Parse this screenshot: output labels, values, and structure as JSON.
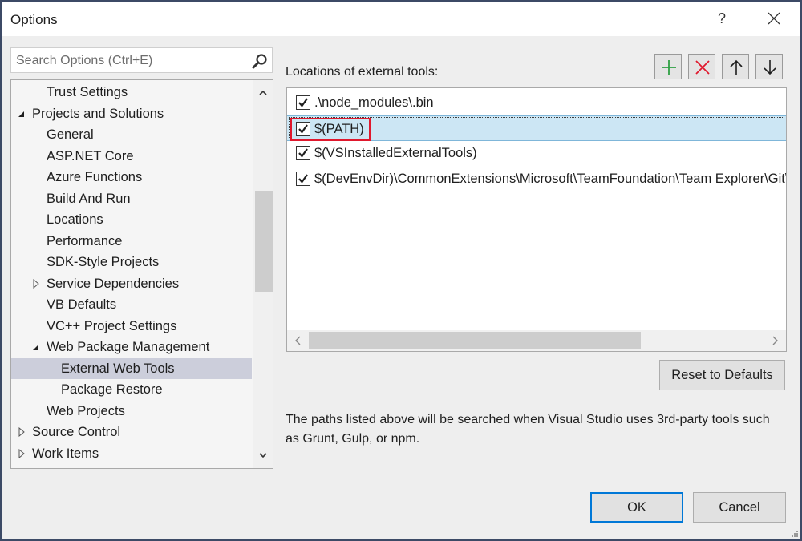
{
  "window": {
    "title": "Options",
    "help_label": "?",
    "close_icon": "close-icon"
  },
  "search": {
    "placeholder": "Search Options (Ctrl+E)",
    "value": "",
    "icon": "search-icon"
  },
  "tree": {
    "items": [
      {
        "label": "Trust Settings",
        "level": 1,
        "expander": "none",
        "selected": false
      },
      {
        "label": "Projects and Solutions",
        "level": 0,
        "expander": "expanded",
        "selected": false
      },
      {
        "label": "General",
        "level": 1,
        "expander": "none",
        "selected": false
      },
      {
        "label": "ASP.NET Core",
        "level": 1,
        "expander": "none",
        "selected": false
      },
      {
        "label": "Azure Functions",
        "level": 1,
        "expander": "none",
        "selected": false
      },
      {
        "label": "Build And Run",
        "level": 1,
        "expander": "none",
        "selected": false
      },
      {
        "label": "Locations",
        "level": 1,
        "expander": "none",
        "selected": false
      },
      {
        "label": "Performance",
        "level": 1,
        "expander": "none",
        "selected": false
      },
      {
        "label": "SDK-Style Projects",
        "level": 1,
        "expander": "none",
        "selected": false
      },
      {
        "label": "Service Dependencies",
        "level": 1,
        "expander": "collapsed",
        "selected": false
      },
      {
        "label": "VB Defaults",
        "level": 1,
        "expander": "none",
        "selected": false
      },
      {
        "label": "VC++ Project Settings",
        "level": 1,
        "expander": "none",
        "selected": false
      },
      {
        "label": "Web Package Management",
        "level": 1,
        "expander": "expanded",
        "selected": false
      },
      {
        "label": "External Web Tools",
        "level": 2,
        "expander": "none",
        "selected": true
      },
      {
        "label": "Package Restore",
        "level": 2,
        "expander": "none",
        "selected": false
      },
      {
        "label": "Web Projects",
        "level": 1,
        "expander": "none",
        "selected": false
      },
      {
        "label": "Source Control",
        "level": 0,
        "expander": "collapsed",
        "selected": false
      },
      {
        "label": "Work Items",
        "level": 0,
        "expander": "collapsed",
        "selected": false
      }
    ],
    "scroll_up_glyph": "^",
    "scroll_down_glyph": "v"
  },
  "locations": {
    "label": "Locations of external tools:",
    "toolbar": [
      {
        "name": "add-button",
        "icon": "plus-icon",
        "color": "#2ea043"
      },
      {
        "name": "remove-button",
        "icon": "x-icon",
        "color": "#e0182d"
      },
      {
        "name": "move-up-button",
        "icon": "arrow-up-icon",
        "color": "#1e1e1e"
      },
      {
        "name": "move-down-button",
        "icon": "arrow-down-icon",
        "color": "#1e1e1e"
      }
    ],
    "rows": [
      {
        "label": ".\\node_modules\\.bin",
        "checked": true,
        "selected": false
      },
      {
        "label": "$(PATH)",
        "checked": true,
        "selected": true,
        "highlighted": true
      },
      {
        "label": "$(VSInstalledExternalTools)",
        "checked": true,
        "selected": false
      },
      {
        "label": "$(DevEnvDir)\\CommonExtensions\\Microsoft\\TeamFoundation\\Team Explorer\\Git\\cmd",
        "checked": true,
        "selected": false
      }
    ],
    "hscroll_left_glyph": "‹",
    "hscroll_right_glyph": "›"
  },
  "reset_button": "Reset to Defaults",
  "description": "The paths listed above will be searched when Visual Studio uses 3rd-party tools such as Grunt, Gulp, or npm.",
  "footer": {
    "ok_label": "OK",
    "cancel_label": "Cancel"
  },
  "colors": {
    "selection_tree": "#cccedb",
    "selection_list": "#cce6f4",
    "highlight_box": "#e0182d",
    "default_button_border": "#0078d7"
  }
}
